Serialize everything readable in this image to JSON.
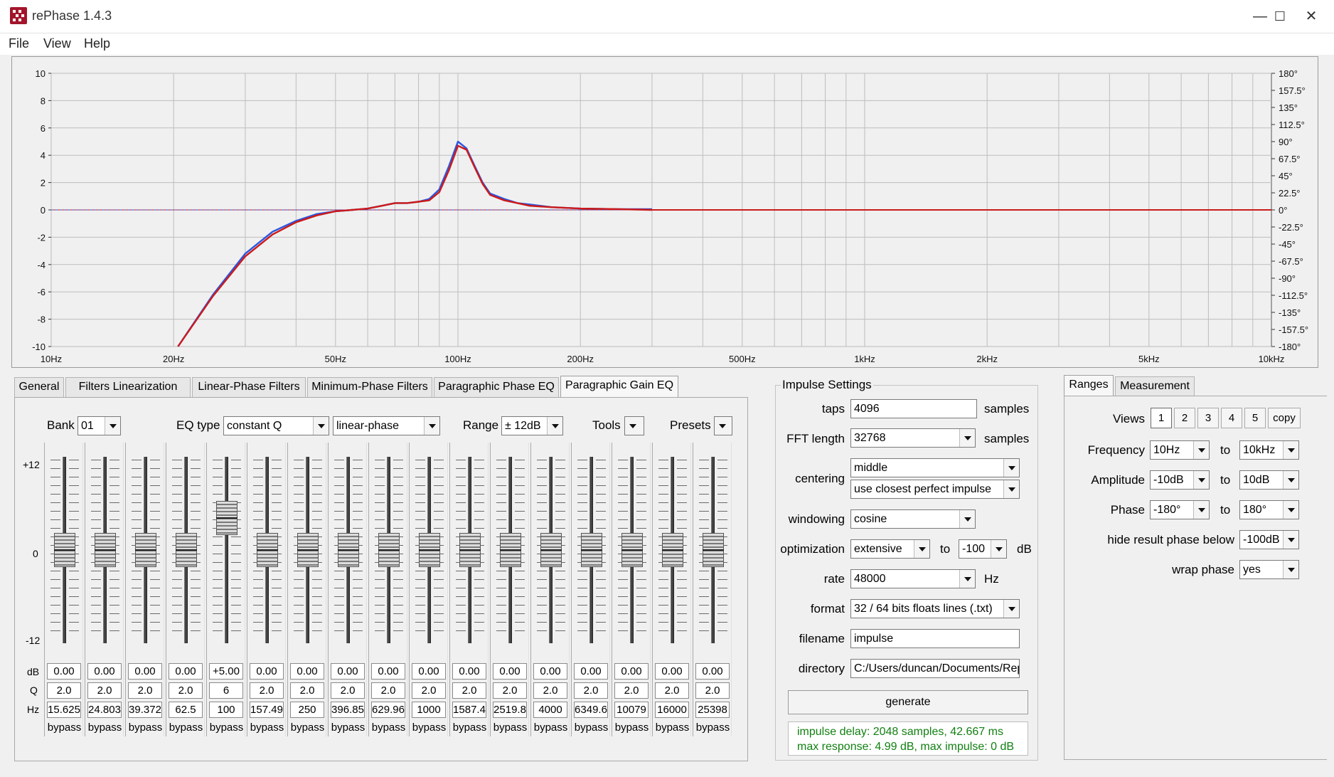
{
  "window": {
    "title": "rePhase 1.4.3",
    "minimize_glyph": "—",
    "maximize_glyph": "☐",
    "close_glyph": "✕"
  },
  "menu": [
    "File",
    "View",
    "Help"
  ],
  "plot": {
    "y_ticks": [
      "10",
      "8",
      "6",
      "4",
      "2",
      "0",
      "-2",
      "-4",
      "-6",
      "-8",
      "-10"
    ],
    "phase_ticks": [
      "180°",
      "157.5°",
      "135°",
      "112.5°",
      "90°",
      "67.5°",
      "45°",
      "22.5°",
      "0°",
      "-22.5°",
      "-45°",
      "-67.5°",
      "-90°",
      "-112.5°",
      "-135°",
      "-157.5°",
      "-180°"
    ],
    "x_labels": [
      {
        "f": 10,
        "t": "10Hz"
      },
      {
        "f": 20,
        "t": "20Hz"
      },
      {
        "f": 50,
        "t": "50Hz"
      },
      {
        "f": 100,
        "t": "100Hz"
      },
      {
        "f": 200,
        "t": "200Hz"
      },
      {
        "f": 500,
        "t": "500Hz"
      },
      {
        "f": 1000,
        "t": "1kHz"
      },
      {
        "f": 2000,
        "t": "2kHz"
      },
      {
        "f": 5000,
        "t": "5kHz"
      },
      {
        "f": 10000,
        "t": "10kHz"
      }
    ],
    "colors": {
      "blue": "#2a56e0",
      "red": "#cc1a1a",
      "grid": "#bdbdbd"
    }
  },
  "chart_data": {
    "type": "line",
    "xlim": [
      10,
      10000
    ],
    "ylim": [
      -10,
      10
    ],
    "y2lim": [
      -180,
      180
    ],
    "x_scale": "log",
    "grid": true,
    "series": [
      {
        "color": "blue",
        "x": [
          20.5,
          25,
          30,
          35,
          40,
          45,
          50,
          55,
          60,
          65,
          70,
          75,
          80,
          85,
          90,
          95,
          100,
          105,
          110,
          115,
          120,
          130,
          140,
          150,
          170,
          200,
          250,
          300
        ],
        "y": [
          -10,
          -6.2,
          -3.2,
          -1.6,
          -0.8,
          -0.3,
          -0.1,
          0,
          0.1,
          0.3,
          0.5,
          0.5,
          0.6,
          0.8,
          1.5,
          3.2,
          5.0,
          4.5,
          3.2,
          2.0,
          1.2,
          0.8,
          0.5,
          0.4,
          0.2,
          0.1,
          0.05,
          0.05
        ]
      },
      {
        "color": "red",
        "x": [
          20.5,
          25,
          30,
          35,
          40,
          45,
          50,
          55,
          60,
          65,
          70,
          75,
          80,
          85,
          90,
          95,
          100,
          105,
          110,
          115,
          120,
          130,
          140,
          150,
          170,
          200,
          250,
          300
        ],
        "y": [
          -10,
          -6.3,
          -3.4,
          -1.8,
          -0.9,
          -0.4,
          -0.1,
          0,
          0.1,
          0.3,
          0.5,
          0.5,
          0.6,
          0.7,
          1.3,
          2.9,
          4.7,
          4.4,
          3.1,
          1.9,
          1.1,
          0.7,
          0.5,
          0.3,
          0.2,
          0.1,
          0.05,
          0.0
        ]
      }
    ]
  },
  "tabs_left": [
    "General",
    "Filters Linearization",
    "Linear-Phase Filters",
    "Minimum-Phase Filters",
    "Paragraphic Phase EQ",
    "Paragraphic Gain EQ"
  ],
  "eq": {
    "bank_label": "Bank",
    "bank_value": "01",
    "eqtype_label": "EQ type",
    "eqtype_value": "constant Q",
    "phase_value": "linear-phase",
    "range_label": "Range",
    "range_value": "± 12dB",
    "tools_label": "Tools",
    "presets_label": "Presets",
    "scale_top": "+12",
    "scale_mid": "0",
    "scale_bot": "-12",
    "row_db": "dB",
    "row_q": "Q",
    "row_hz": "Hz",
    "bands": [
      {
        "db": "0.00",
        "q": "2.0",
        "hz": "15.625",
        "bypass": "bypass",
        "level": 0.5
      },
      {
        "db": "0.00",
        "q": "2.0",
        "hz": "24.803",
        "bypass": "bypass",
        "level": 0.5
      },
      {
        "db": "0.00",
        "q": "2.0",
        "hz": "39.372",
        "bypass": "bypass",
        "level": 0.5
      },
      {
        "db": "0.00",
        "q": "2.0",
        "hz": "62.5",
        "bypass": "bypass",
        "level": 0.5
      },
      {
        "db": "+5.00",
        "q": "6",
        "hz": "100",
        "bypass": "bypass",
        "level": 0.708
      },
      {
        "db": "0.00",
        "q": "2.0",
        "hz": "157.49",
        "bypass": "bypass",
        "level": 0.5
      },
      {
        "db": "0.00",
        "q": "2.0",
        "hz": "250",
        "bypass": "bypass",
        "level": 0.5
      },
      {
        "db": "0.00",
        "q": "2.0",
        "hz": "396.85",
        "bypass": "bypass",
        "level": 0.5
      },
      {
        "db": "0.00",
        "q": "2.0",
        "hz": "629.96",
        "bypass": "bypass",
        "level": 0.5
      },
      {
        "db": "0.00",
        "q": "2.0",
        "hz": "1000",
        "bypass": "bypass",
        "level": 0.5
      },
      {
        "db": "0.00",
        "q": "2.0",
        "hz": "1587.4",
        "bypass": "bypass",
        "level": 0.5
      },
      {
        "db": "0.00",
        "q": "2.0",
        "hz": "2519.8",
        "bypass": "bypass",
        "level": 0.5
      },
      {
        "db": "0.00",
        "q": "2.0",
        "hz": "4000",
        "bypass": "bypass",
        "level": 0.5
      },
      {
        "db": "0.00",
        "q": "2.0",
        "hz": "6349.6",
        "bypass": "bypass",
        "level": 0.5
      },
      {
        "db": "0.00",
        "q": "2.0",
        "hz": "10079",
        "bypass": "bypass",
        "level": 0.5
      },
      {
        "db": "0.00",
        "q": "2.0",
        "hz": "16000",
        "bypass": "bypass",
        "level": 0.5
      },
      {
        "db": "0.00",
        "q": "2.0",
        "hz": "25398",
        "bypass": "bypass",
        "level": 0.5
      }
    ]
  },
  "impulse": {
    "title": "Impulse Settings",
    "taps_label": "taps",
    "taps_value": "4096",
    "taps_unit": "samples",
    "fft_label": "FFT length",
    "fft_value": "32768",
    "fft_unit": "samples",
    "centering_label": "centering",
    "centering_value": "middle",
    "centering_value2": "use closest perfect impulse",
    "windowing_label": "windowing",
    "windowing_value": "cosine",
    "optimization_label": "optimization",
    "optimization_value": "extensive",
    "optimization_to": "to",
    "optimization_db_value": "-100",
    "optimization_unit": "dB",
    "rate_label": "rate",
    "rate_value": "48000",
    "rate_unit": "Hz",
    "format_label": "format",
    "format_value": "32 / 64 bits floats lines (.txt)",
    "filename_label": "filename",
    "filename_value": "impulse",
    "directory_label": "directory",
    "directory_value": "C:/Users/duncan/Documents/Rep",
    "generate_label": "generate",
    "status_line1": "impulse delay: 2048 samples, 42.667 ms",
    "status_line2": "max response: 4.99 dB, max impulse: 0 dB"
  },
  "tabs_right": [
    "Ranges",
    "Measurement"
  ],
  "ranges": {
    "views_label": "Views",
    "views": [
      "1",
      "2",
      "3",
      "4",
      "5",
      "copy"
    ],
    "frequency_label": "Frequency",
    "frequency_from": "10Hz",
    "frequency_to": "10kHz",
    "amplitude_label": "Amplitude",
    "amplitude_from": "-10dB",
    "amplitude_to": "10dB",
    "phase_label": "Phase",
    "phase_from": "-180°",
    "phase_to": "180°",
    "to_label": "to",
    "hide_label": "hide result phase below",
    "hide_value": "-100dB",
    "wrap_label": "wrap phase",
    "wrap_value": "yes"
  }
}
